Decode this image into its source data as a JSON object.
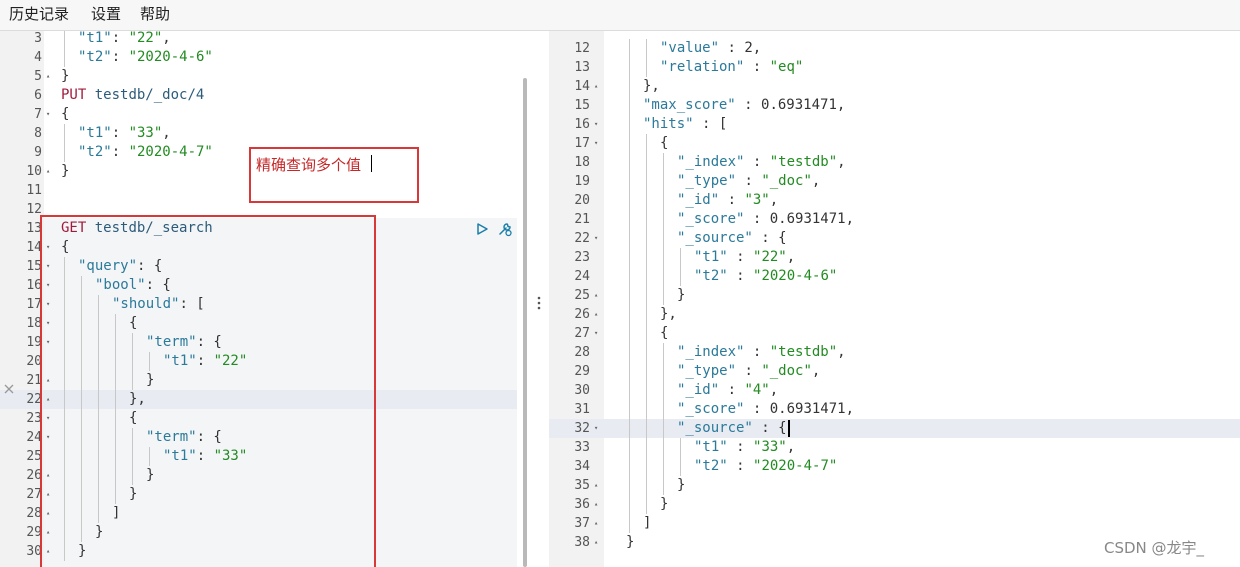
{
  "menu": [
    "历史记录",
    "设置",
    "帮助"
  ],
  "annotation": "精确查询多个值",
  "watermark": "CSDN @龙宇_",
  "left_lines": [
    {
      "n": "3",
      "fold": "",
      "d": 1,
      "t": [
        [
          "\"t1\"",
          "k"
        ],
        [
          ": ",
          "n"
        ],
        [
          "\"22\"",
          "s"
        ],
        [
          ",",
          "n"
        ]
      ]
    },
    {
      "n": "4",
      "fold": "",
      "d": 1,
      "t": [
        [
          "\"t2\"",
          "k"
        ],
        [
          ": ",
          "n"
        ],
        [
          "\"2020-4-6\"",
          "s"
        ]
      ]
    },
    {
      "n": "5",
      "fold": "▴",
      "d": 0,
      "t": [
        [
          "}",
          "n"
        ]
      ]
    },
    {
      "n": "6",
      "fold": "",
      "d": 0,
      "t": [
        [
          "PUT",
          "m"
        ],
        [
          " testdb/_doc/4",
          "u"
        ]
      ]
    },
    {
      "n": "7",
      "fold": "▾",
      "d": 0,
      "t": [
        [
          "{",
          "n"
        ]
      ]
    },
    {
      "n": "8",
      "fold": "",
      "d": 1,
      "t": [
        [
          "\"t1\"",
          "k"
        ],
        [
          ": ",
          "n"
        ],
        [
          "\"33\"",
          "s"
        ],
        [
          ",",
          "n"
        ]
      ]
    },
    {
      "n": "9",
      "fold": "",
      "d": 1,
      "t": [
        [
          "\"t2\"",
          "k"
        ],
        [
          ": ",
          "n"
        ],
        [
          "\"2020-4-7\"",
          "s"
        ]
      ]
    },
    {
      "n": "10",
      "fold": "▴",
      "d": 0,
      "t": [
        [
          "}",
          "n"
        ]
      ]
    },
    {
      "n": "11",
      "fold": "",
      "d": 0,
      "t": []
    },
    {
      "n": "12",
      "fold": "",
      "d": 0,
      "t": []
    },
    {
      "n": "13",
      "fold": "",
      "d": 0,
      "t": [
        [
          "GET",
          "m"
        ],
        [
          " testdb/_search",
          "u"
        ]
      ]
    },
    {
      "n": "14",
      "fold": "▾",
      "d": 0,
      "t": [
        [
          "{",
          "n"
        ]
      ]
    },
    {
      "n": "15",
      "fold": "▾",
      "d": 1,
      "t": [
        [
          "\"query\"",
          "k"
        ],
        [
          ": {",
          "n"
        ]
      ]
    },
    {
      "n": "16",
      "fold": "▾",
      "d": 2,
      "t": [
        [
          "\"bool\"",
          "k"
        ],
        [
          ": {",
          "n"
        ]
      ]
    },
    {
      "n": "17",
      "fold": "▾",
      "d": 3,
      "t": [
        [
          "\"should\"",
          "k"
        ],
        [
          ": [",
          "n"
        ]
      ]
    },
    {
      "n": "18",
      "fold": "▾",
      "d": 4,
      "t": [
        [
          "{",
          "n"
        ]
      ]
    },
    {
      "n": "19",
      "fold": "▾",
      "d": 5,
      "t": [
        [
          "\"term\"",
          "k"
        ],
        [
          ": {",
          "n"
        ]
      ]
    },
    {
      "n": "20",
      "fold": "",
      "d": 6,
      "t": [
        [
          "\"t1\"",
          "k"
        ],
        [
          ": ",
          "n"
        ],
        [
          "\"22\"",
          "s"
        ]
      ]
    },
    {
      "n": "21",
      "fold": "▴",
      "d": 5,
      "t": [
        [
          "}",
          "n"
        ]
      ]
    },
    {
      "n": "22",
      "fold": "▴",
      "d": 4,
      "t": [
        [
          "},",
          "n"
        ]
      ]
    },
    {
      "n": "23",
      "fold": "▾",
      "d": 4,
      "t": [
        [
          "{",
          "n"
        ]
      ]
    },
    {
      "n": "24",
      "fold": "▾",
      "d": 5,
      "t": [
        [
          "\"term\"",
          "k"
        ],
        [
          ": {",
          "n"
        ]
      ]
    },
    {
      "n": "25",
      "fold": "",
      "d": 6,
      "t": [
        [
          "\"t1\"",
          "k"
        ],
        [
          ": ",
          "n"
        ],
        [
          "\"33\"",
          "s"
        ]
      ]
    },
    {
      "n": "26",
      "fold": "▴",
      "d": 5,
      "t": [
        [
          "}",
          "n"
        ]
      ]
    },
    {
      "n": "27",
      "fold": "▴",
      "d": 4,
      "t": [
        [
          "}",
          "n"
        ]
      ]
    },
    {
      "n": "28",
      "fold": "▴",
      "d": 3,
      "t": [
        [
          "]",
          "n"
        ]
      ]
    },
    {
      "n": "29",
      "fold": "▴",
      "d": 2,
      "t": [
        [
          "}",
          "n"
        ]
      ]
    },
    {
      "n": "30",
      "fold": "▴",
      "d": 1,
      "t": [
        [
          "}",
          "n"
        ]
      ]
    }
  ],
  "right_lines": [
    {
      "n": "12",
      "fold": "",
      "d": 2,
      "t": [
        [
          "\"value\"",
          "k"
        ],
        [
          " : ",
          "n"
        ],
        [
          "2",
          "n"
        ],
        [
          ",",
          "n"
        ]
      ]
    },
    {
      "n": "13",
      "fold": "",
      "d": 2,
      "t": [
        [
          "\"relation\"",
          "k"
        ],
        [
          " : ",
          "n"
        ],
        [
          "\"eq\"",
          "s"
        ]
      ]
    },
    {
      "n": "14",
      "fold": "▴",
      "d": 1,
      "t": [
        [
          "},",
          "n"
        ]
      ]
    },
    {
      "n": "15",
      "fold": "",
      "d": 1,
      "t": [
        [
          "\"max_score\"",
          "k"
        ],
        [
          " : ",
          "n"
        ],
        [
          "0.6931471",
          "n"
        ],
        [
          ",",
          "n"
        ]
      ]
    },
    {
      "n": "16",
      "fold": "▾",
      "d": 1,
      "t": [
        [
          "\"hits\"",
          "k"
        ],
        [
          " : [",
          "n"
        ]
      ]
    },
    {
      "n": "17",
      "fold": "▾",
      "d": 2,
      "t": [
        [
          "{",
          "n"
        ]
      ]
    },
    {
      "n": "18",
      "fold": "",
      "d": 3,
      "t": [
        [
          "\"_index\"",
          "k"
        ],
        [
          " : ",
          "n"
        ],
        [
          "\"testdb\"",
          "s"
        ],
        [
          ",",
          "n"
        ]
      ]
    },
    {
      "n": "19",
      "fold": "",
      "d": 3,
      "t": [
        [
          "\"_type\"",
          "k"
        ],
        [
          " : ",
          "n"
        ],
        [
          "\"_doc\"",
          "s"
        ],
        [
          ",",
          "n"
        ]
      ]
    },
    {
      "n": "20",
      "fold": "",
      "d": 3,
      "t": [
        [
          "\"_id\"",
          "k"
        ],
        [
          " : ",
          "n"
        ],
        [
          "\"3\"",
          "s"
        ],
        [
          ",",
          "n"
        ]
      ]
    },
    {
      "n": "21",
      "fold": "",
      "d": 3,
      "t": [
        [
          "\"_score\"",
          "k"
        ],
        [
          " : ",
          "n"
        ],
        [
          "0.6931471",
          "n"
        ],
        [
          ",",
          "n"
        ]
      ]
    },
    {
      "n": "22",
      "fold": "▾",
      "d": 3,
      "t": [
        [
          "\"_source\"",
          "k"
        ],
        [
          " : {",
          "n"
        ]
      ]
    },
    {
      "n": "23",
      "fold": "",
      "d": 4,
      "t": [
        [
          "\"t1\"",
          "k"
        ],
        [
          " : ",
          "n"
        ],
        [
          "\"22\"",
          "s"
        ],
        [
          ",",
          "n"
        ]
      ]
    },
    {
      "n": "24",
      "fold": "",
      "d": 4,
      "t": [
        [
          "\"t2\"",
          "k"
        ],
        [
          " : ",
          "n"
        ],
        [
          "\"2020-4-6\"",
          "s"
        ]
      ]
    },
    {
      "n": "25",
      "fold": "▴",
      "d": 3,
      "t": [
        [
          "}",
          "n"
        ]
      ]
    },
    {
      "n": "26",
      "fold": "▴",
      "d": 2,
      "t": [
        [
          "},",
          "n"
        ]
      ]
    },
    {
      "n": "27",
      "fold": "▾",
      "d": 2,
      "t": [
        [
          "{",
          "n"
        ]
      ]
    },
    {
      "n": "28",
      "fold": "",
      "d": 3,
      "t": [
        [
          "\"_index\"",
          "k"
        ],
        [
          " : ",
          "n"
        ],
        [
          "\"testdb\"",
          "s"
        ],
        [
          ",",
          "n"
        ]
      ]
    },
    {
      "n": "29",
      "fold": "",
      "d": 3,
      "t": [
        [
          "\"_type\"",
          "k"
        ],
        [
          " : ",
          "n"
        ],
        [
          "\"_doc\"",
          "s"
        ],
        [
          ",",
          "n"
        ]
      ]
    },
    {
      "n": "30",
      "fold": "",
      "d": 3,
      "t": [
        [
          "\"_id\"",
          "k"
        ],
        [
          " : ",
          "n"
        ],
        [
          "\"4\"",
          "s"
        ],
        [
          ",",
          "n"
        ]
      ]
    },
    {
      "n": "31",
      "fold": "",
      "d": 3,
      "t": [
        [
          "\"_score\"",
          "k"
        ],
        [
          " : ",
          "n"
        ],
        [
          "0.6931471",
          "n"
        ],
        [
          ",",
          "n"
        ]
      ]
    },
    {
      "n": "32",
      "fold": "▾",
      "d": 3,
      "t": [
        [
          "\"_source\"",
          "k"
        ],
        [
          " : {",
          "n"
        ]
      ]
    },
    {
      "n": "33",
      "fold": "",
      "d": 4,
      "t": [
        [
          "\"t1\"",
          "k"
        ],
        [
          " : ",
          "n"
        ],
        [
          "\"33\"",
          "s"
        ],
        [
          ",",
          "n"
        ]
      ]
    },
    {
      "n": "34",
      "fold": "",
      "d": 4,
      "t": [
        [
          "\"t2\"",
          "k"
        ],
        [
          " : ",
          "n"
        ],
        [
          "\"2020-4-7\"",
          "s"
        ]
      ]
    },
    {
      "n": "35",
      "fold": "▴",
      "d": 3,
      "t": [
        [
          "}",
          "n"
        ]
      ]
    },
    {
      "n": "36",
      "fold": "▴",
      "d": 2,
      "t": [
        [
          "}",
          "n"
        ]
      ]
    },
    {
      "n": "37",
      "fold": "▴",
      "d": 1,
      "t": [
        [
          "]",
          "n"
        ]
      ]
    },
    {
      "n": "38",
      "fold": "▴",
      "d": 0,
      "t": [
        [
          "}",
          "n"
        ]
      ]
    }
  ]
}
